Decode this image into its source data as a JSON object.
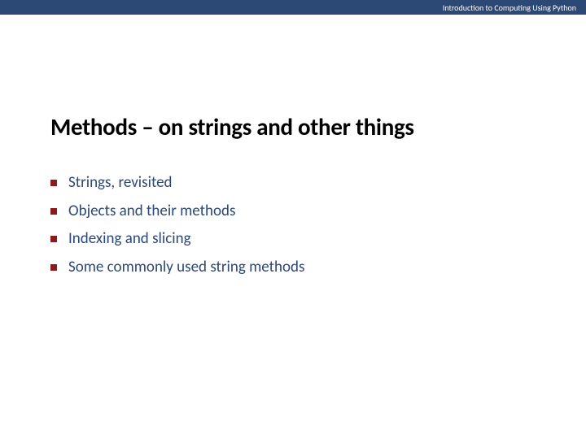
{
  "header": {
    "course_title": "Introduction to Computing Using Python"
  },
  "slide": {
    "title": "Methods – on strings and other things",
    "bullets": [
      "Strings, revisited",
      "Objects and their methods",
      "Indexing and slicing",
      "Some commonly used string methods"
    ]
  }
}
